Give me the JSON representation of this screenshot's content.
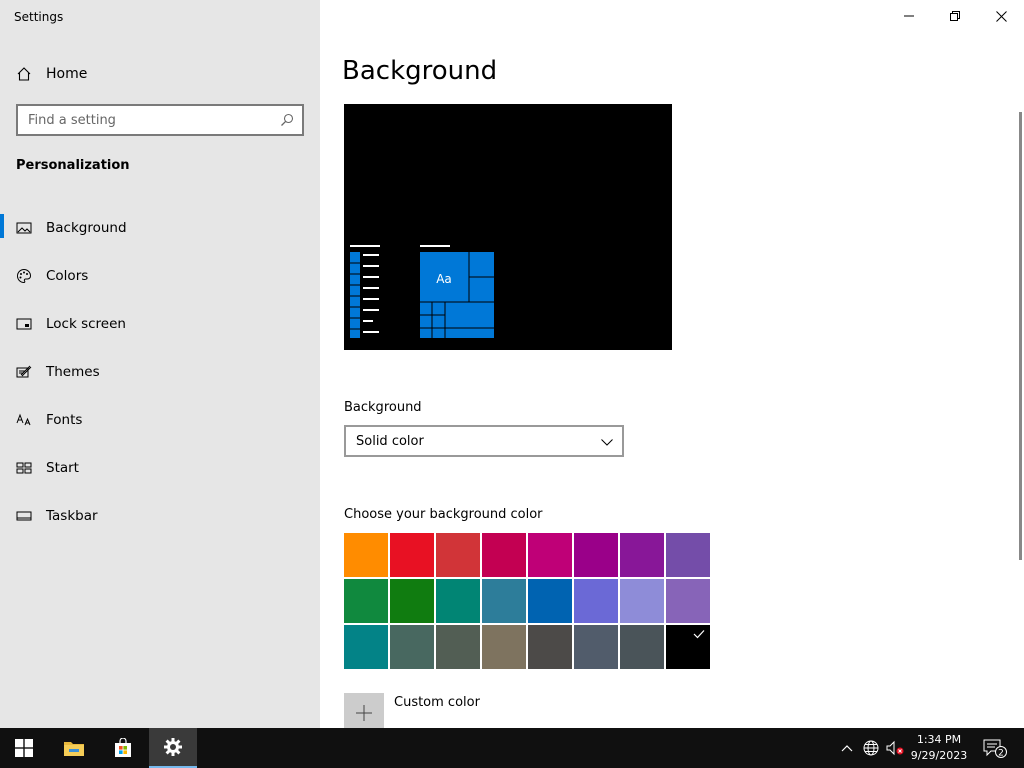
{
  "window": {
    "title": "Settings",
    "controls": [
      "minimize-icon",
      "restore-icon",
      "close-icon"
    ]
  },
  "sidebar": {
    "home_label": "Home",
    "search_placeholder": "Find a setting",
    "section_title": "Personalization",
    "items": [
      {
        "label": "Background",
        "icon": "picture-icon",
        "active": true
      },
      {
        "label": "Colors",
        "icon": "palette-icon"
      },
      {
        "label": "Lock screen",
        "icon": "lock-screen-icon"
      },
      {
        "label": "Themes",
        "icon": "themes-icon"
      },
      {
        "label": "Fonts",
        "icon": "fonts-icon"
      },
      {
        "label": "Start",
        "icon": "start-icon"
      },
      {
        "label": "Taskbar",
        "icon": "taskbar-icon"
      }
    ]
  },
  "main": {
    "title": "Background",
    "preview": {
      "sample_text": "Aa",
      "background": "#000000",
      "accent": "#0078d7"
    },
    "background_label": "Background",
    "background_value": "Solid color",
    "choose_color_label": "Choose your background color",
    "swatches": [
      "#ff8c00",
      "#e81123",
      "#d13438",
      "#c30052",
      "#bf0077",
      "#9a0089",
      "#881798",
      "#744da9",
      "#10893e",
      "#107c10",
      "#018574",
      "#2d7d9a",
      "#0063b1",
      "#6b69d6",
      "#8e8cd8",
      "#8764b8",
      "#038387",
      "#486860",
      "#525e54",
      "#7e735f",
      "#4c4a48",
      "#515c6b",
      "#4a5459",
      "#000000"
    ],
    "selected_swatch": "#000000",
    "custom_color_label": "Custom color"
  },
  "taskbar": {
    "apps": [
      "windows-start-icon",
      "file-explorer-icon",
      "store-icon",
      "settings-icon"
    ],
    "active_app": "settings-icon",
    "time": "1:34 PM",
    "date": "9/29/2023",
    "notification_count": "2"
  }
}
